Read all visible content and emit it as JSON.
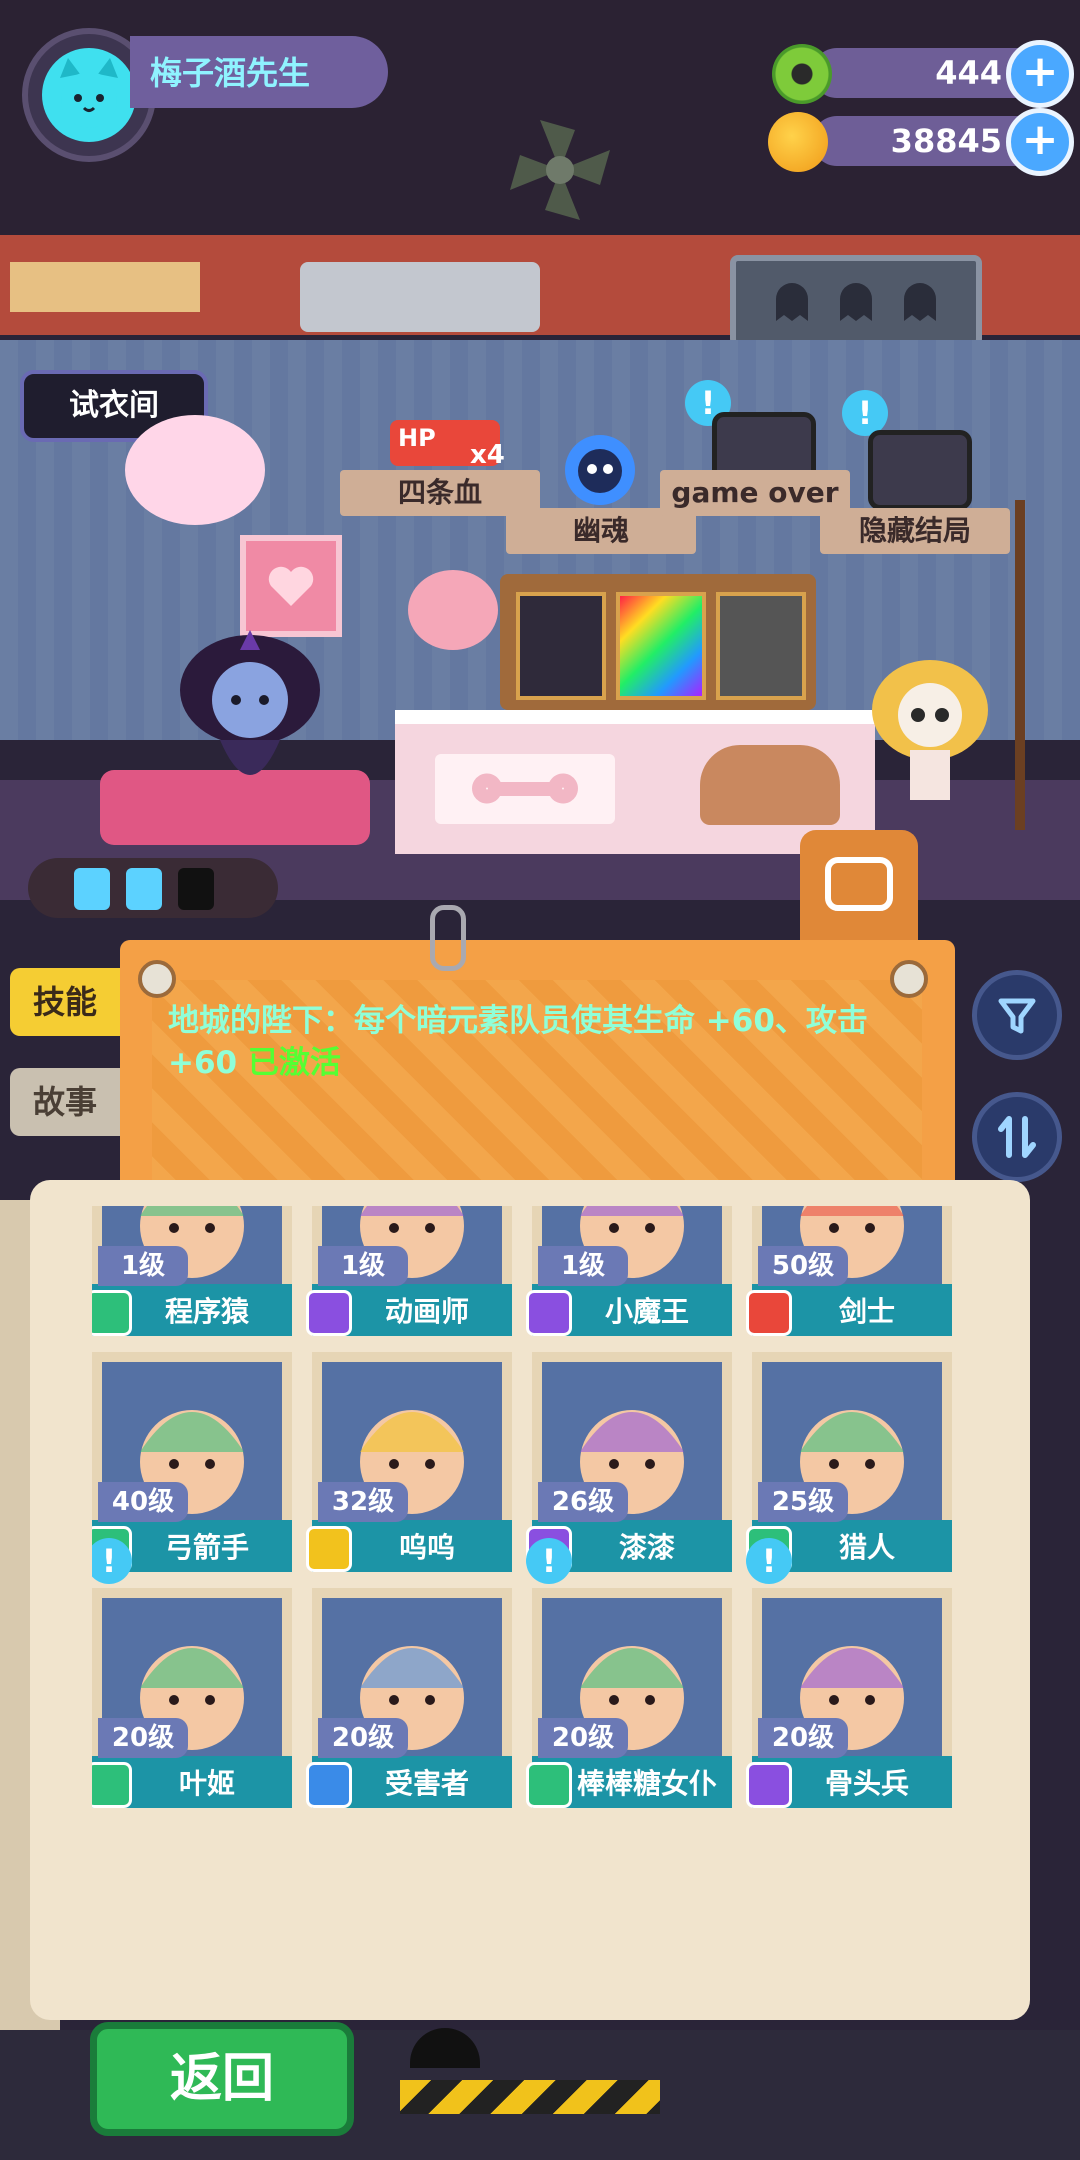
{
  "player": {
    "name": "梅子酒先生"
  },
  "currency": [
    {
      "icon": "donut-coin-icon",
      "value": "444"
    },
    {
      "icon": "planet-gem-icon",
      "value": "38845"
    }
  ],
  "room": {
    "fitting_room_label": "试衣间",
    "banners": [
      "四条血",
      "幽魂",
      "game over",
      "隐藏结局"
    ],
    "hp_badge": "HP",
    "hp_multiplier": "x4",
    "notification_symbol": "!"
  },
  "tabs": {
    "skill": "技能",
    "story": "故事"
  },
  "skill": {
    "text": "地城的陛下：每个暗元素队员使其生命 +60、攻击 +60",
    "status": "已激活"
  },
  "roster": [
    {
      "level": "1级",
      "name": "程序猿",
      "role_color": "#2dbf7a",
      "has_notice": false
    },
    {
      "level": "1级",
      "name": "动画师",
      "role_color": "#8a4fe0",
      "has_notice": false
    },
    {
      "level": "1级",
      "name": "小魔王",
      "role_color": "#8a4fe0",
      "has_notice": false
    },
    {
      "level": "50级",
      "name": "剑士",
      "role_color": "#e9473a",
      "has_notice": false
    },
    {
      "level": "40级",
      "name": "弓箭手",
      "role_color": "#2dbf7a",
      "has_notice": false
    },
    {
      "level": "32级",
      "name": "呜呜",
      "role_color": "#f2c21d",
      "has_notice": false
    },
    {
      "level": "26级",
      "name": "漆漆",
      "role_color": "#8a4fe0",
      "has_notice": false
    },
    {
      "level": "25级",
      "name": "猎人",
      "role_color": "#2dbf7a",
      "has_notice": false
    },
    {
      "level": "20级",
      "name": "叶姬",
      "role_color": "#2dbf7a",
      "has_notice": true
    },
    {
      "level": "20级",
      "name": "受害者",
      "role_color": "#3a8be8",
      "has_notice": false
    },
    {
      "level": "20级",
      "name": "棒棒糖女仆",
      "role_color": "#2dbf7a",
      "has_notice": true
    },
    {
      "level": "20级",
      "name": "骨头兵",
      "role_color": "#8a4fe0",
      "has_notice": true
    }
  ],
  "back_label": "返回"
}
